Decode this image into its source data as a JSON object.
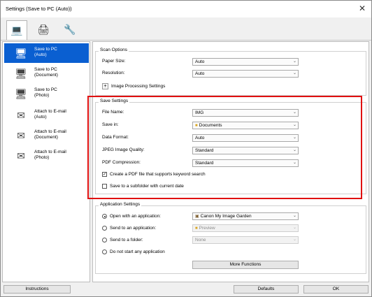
{
  "window": {
    "title": "Settings (Save to PC (Auto))",
    "close_glyph": "✕"
  },
  "tabs": [
    {
      "icon": "computer-icon",
      "glyph": "💻"
    },
    {
      "icon": "scanner-icon",
      "glyph": "🖨"
    },
    {
      "icon": "tools-icon",
      "glyph": "🔧"
    }
  ],
  "sidebar": {
    "items": [
      {
        "label": "Save to PC\n(Auto)",
        "glyph": "🖥"
      },
      {
        "label": "Save to PC\n(Document)",
        "glyph": "🖥"
      },
      {
        "label": "Save to PC\n(Photo)",
        "glyph": "🖥"
      },
      {
        "label": "Attach to E-mail\n(Auto)",
        "glyph": "✉"
      },
      {
        "label": "Attach to E-mail\n(Document)",
        "glyph": "✉"
      },
      {
        "label": "Attach to E-mail\n(Photo)",
        "glyph": "✉"
      }
    ]
  },
  "scan_options": {
    "title": "Scan Options",
    "paper_size_label": "Paper Size:",
    "paper_size_value": "Auto",
    "resolution_label": "Resolution:",
    "resolution_value": "Auto",
    "image_processing_label": "Image Processing Settings",
    "plus_glyph": "+"
  },
  "save_settings": {
    "title": "Save Settings",
    "file_name_label": "File Name:",
    "file_name_value": "IMG",
    "save_in_label": "Save in:",
    "save_in_value": "Documents",
    "data_format_label": "Data Format:",
    "data_format_value": "Auto",
    "jpeg_quality_label": "JPEG Image Quality:",
    "jpeg_quality_value": "Standard",
    "pdf_compression_label": "PDF Compression:",
    "pdf_compression_value": "Standard",
    "keyword_search_label": "Create a PDF file that supports keyword search",
    "keyword_search_checked": true,
    "subfolder_label": "Save to a subfolder with current date",
    "subfolder_checked": false,
    "check_glyph": "✓"
  },
  "application_settings": {
    "title": "Application Settings",
    "open_with_label": "Open with an application:",
    "open_with_value": "Canon My Image Garden",
    "send_to_app_label": "Send to an application:",
    "send_to_app_value": "Preview",
    "send_to_folder_label": "Send to a folder:",
    "send_to_folder_value": "None",
    "do_not_start_label": "Do not start any application",
    "more_functions_label": "More Functions",
    "selected_option": "open_with"
  },
  "footer": {
    "instructions_label": "Instructions",
    "defaults_label": "Defaults",
    "ok_label": "OK"
  },
  "colors": {
    "selected_item": "#0a5fd1",
    "highlight_frame": "#e01010"
  },
  "dropdown_arrow": "⌄"
}
